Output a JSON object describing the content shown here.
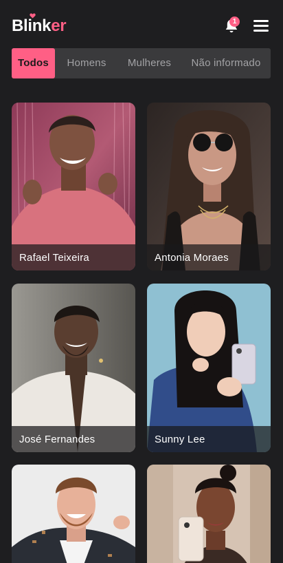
{
  "app": {
    "logo_part1": "Blink",
    "logo_part2": "er",
    "notification_count": "1",
    "accent": "#ff5f85",
    "background": "#1e1e20"
  },
  "icons": {
    "logo_heart": "heart-icon",
    "notifications": "bell-icon",
    "menu": "hamburger-menu-icon"
  },
  "tabs": [
    {
      "label": "Todos",
      "active": true
    },
    {
      "label": "Homens",
      "active": false
    },
    {
      "label": "Mulheres",
      "active": false
    },
    {
      "label": "Não informado",
      "active": false
    }
  ],
  "profiles": [
    {
      "name": "Rafael Teixeira"
    },
    {
      "name": "Antonia Moraes"
    },
    {
      "name": "José Fernandes"
    },
    {
      "name": "Sunny Lee"
    },
    {
      "name": ""
    },
    {
      "name": ""
    }
  ]
}
